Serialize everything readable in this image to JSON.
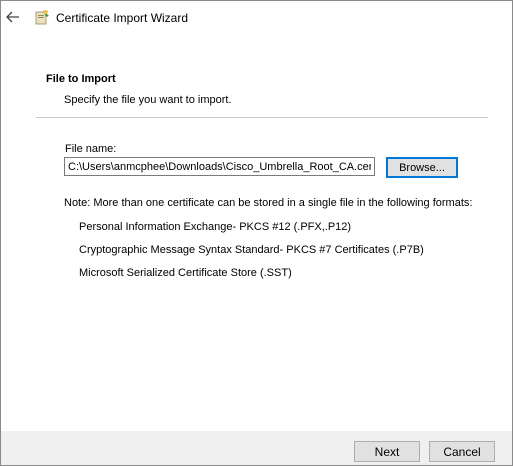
{
  "window": {
    "title": "Certificate Import Wizard"
  },
  "header": {
    "title": "File to Import",
    "subtitle": "Specify the file you want to import."
  },
  "form": {
    "file_label": "File name:",
    "file_value": "C:\\Users\\anmcphee\\Downloads\\Cisco_Umbrella_Root_CA.cer",
    "browse_label": "Browse..."
  },
  "note": {
    "text": "Note:  More than one certificate can be stored in a single file in the following formats:",
    "formats": [
      "Personal Information Exchange- PKCS #12 (.PFX,.P12)",
      "Cryptographic Message Syntax Standard- PKCS #7 Certificates (.P7B)",
      "Microsoft Serialized Certificate Store (.SST)"
    ]
  },
  "footer": {
    "next_label": "Next",
    "cancel_label": "Cancel"
  },
  "icons": {
    "back": "back-arrow-icon",
    "wizard": "certificate-wizard-icon"
  },
  "colors": {
    "accent": "#0078d7",
    "footer_bg": "#f0f0f0"
  }
}
